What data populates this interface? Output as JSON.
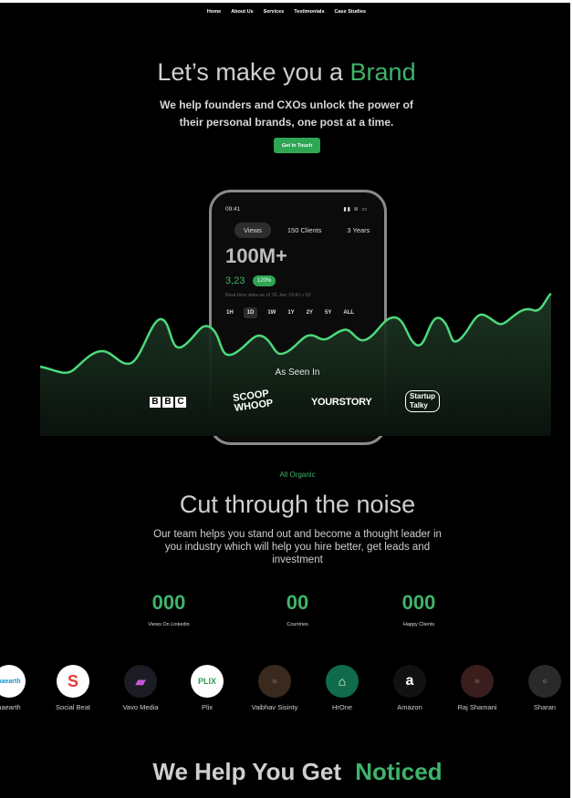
{
  "nav": {
    "items": [
      "Home",
      "About Us",
      "Services",
      "Testimonials",
      "Case Studies"
    ]
  },
  "hero": {
    "title_main": "Let’s make you a",
    "title_accent": "Brand",
    "subtitle": "We help founders and CXOs unlock the power of their personal brands, one post at a time.",
    "cta": "Get In Touch"
  },
  "phone": {
    "time": "09:41",
    "tabs": [
      "Views",
      "150 Clients",
      "3 Years"
    ],
    "big_value": "100M+",
    "value": "3,23",
    "percent": "120%",
    "note": "Real-time data as of 16 Jan 19:41 • 02",
    "ranges": [
      "1H",
      "1D",
      "1W",
      "1Y",
      "2Y",
      "5Y",
      "ALL"
    ]
  },
  "press": {
    "heading": "As Seen In",
    "logos": [
      "BBC",
      "SCOOP WHOOP",
      "YOURSTORY",
      "Startup Talky"
    ]
  },
  "organic": {
    "eyebrow": "All Organic",
    "title": "Cut through the noise",
    "paragraph": "Our team helps you stand out and become a thought leader in you industry which will help you hire better, get leads and investment"
  },
  "stats": [
    {
      "value": "000",
      "label": "Views On Linkedin"
    },
    {
      "value": "00",
      "label": "Countries"
    },
    {
      "value": "000",
      "label": "Happy Clients"
    }
  ],
  "clients": [
    "naearth",
    "Social Beat",
    "Vavo Media",
    "Plix",
    "Vaibhav Sisinty",
    "HrOne",
    "Amazon",
    "Raj Shamani",
    "Sharan"
  ],
  "bottom": {
    "title_main": "We Help You Get",
    "title_accent": "Noticed"
  },
  "colors": {
    "accent": "#3fb36a",
    "button": "#2ea653",
    "background": "#000000"
  }
}
